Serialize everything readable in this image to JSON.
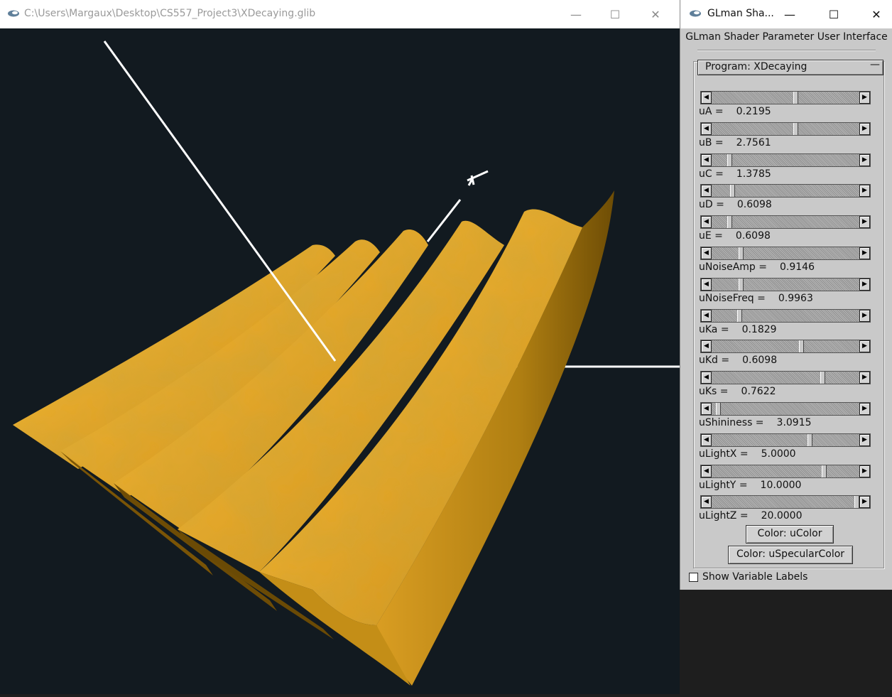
{
  "render_window": {
    "title": "C:\\Users\\Margaux\\Desktop\\CS557_Project3\\XDecaying.glib",
    "minimize": "—",
    "maximize": "☐",
    "close": "✕",
    "background_color": "#121a20",
    "surface_color": "#e3a72a"
  },
  "panel": {
    "title": "GLman Sha...",
    "minimize": "—",
    "maximize": "☐",
    "close": "✕",
    "heading": "GLman Shader Parameter User Interface",
    "program_label": "Program: XDecaying",
    "collapse_symbol": "—",
    "params": [
      {
        "name": "uA =",
        "value": "0.2195",
        "level": 0.57
      },
      {
        "name": "uB =",
        "value": "2.7561",
        "level": 0.57
      },
      {
        "name": "uC =",
        "value": "1.3785",
        "level": 0.11
      },
      {
        "name": "uD =",
        "value": "0.6098",
        "level": 0.13
      },
      {
        "name": "uE =",
        "value": "0.6098",
        "level": 0.11
      },
      {
        "name": "uNoiseAmp =",
        "value": "0.9146",
        "level": 0.19
      },
      {
        "name": "uNoiseFreq =",
        "value": "0.9963",
        "level": 0.19
      },
      {
        "name": "uKa =",
        "value": "0.1829",
        "level": 0.18
      },
      {
        "name": "uKd =",
        "value": "0.6098",
        "level": 0.61
      },
      {
        "name": "uKs =",
        "value": "0.7622",
        "level": 0.76
      },
      {
        "name": "uShininess =",
        "value": "3.0915",
        "level": 0.03
      },
      {
        "name": "uLightX =",
        "value": "5.0000",
        "level": 0.67
      },
      {
        "name": "uLightY =",
        "value": "10.0000",
        "level": 0.77
      },
      {
        "name": "uLightZ =",
        "value": "20.0000",
        "level": 1.0
      }
    ],
    "color_button_1": "Color: uColor",
    "color_button_2": "Color: uSpecularColor",
    "show_labels": "Show Variable Labels"
  }
}
